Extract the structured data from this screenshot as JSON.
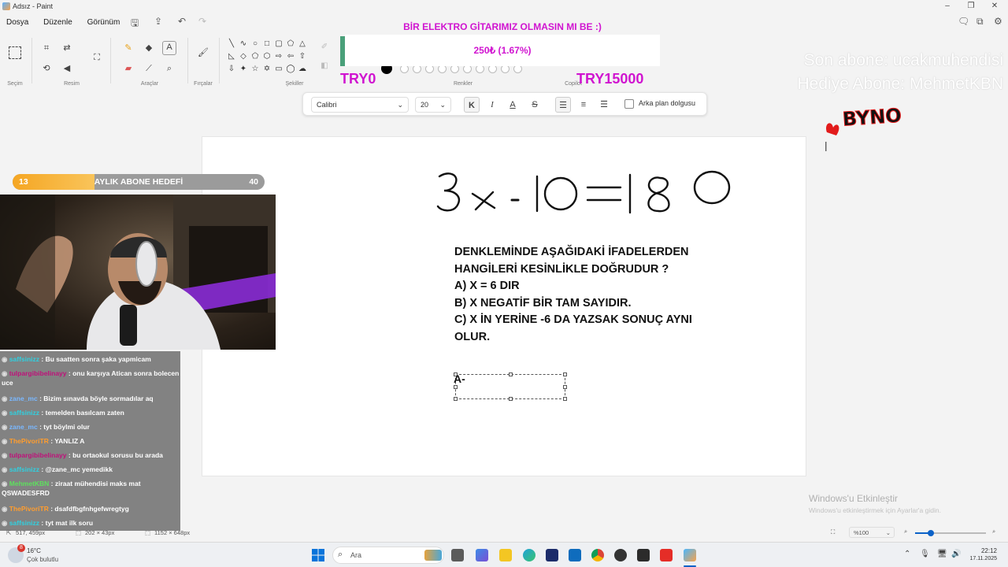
{
  "titlebar": {
    "title": "Adsız - Paint"
  },
  "menu": [
    "Dosya",
    "Düzenle",
    "Görünüm"
  ],
  "ribbon": {
    "groups": [
      "Seçim",
      "Resim",
      "Araçlar",
      "Fırçalar",
      "Şekiller",
      "Renkler",
      "Copilot"
    ]
  },
  "donation": {
    "title": "BİR ELEKTRO GİTARIMIZ OLMASIN MI BE :)",
    "amount": "250₺ (1.67%)",
    "from": "TRY0",
    "to": "TRY15000"
  },
  "last_sub": {
    "line1": "Son abone: ucakmuhendisi",
    "line2": "Hediye Abone: MehmetKBN"
  },
  "brand_logo": "BYNO",
  "text_toolbar": {
    "font": "Calibri",
    "size": "20",
    "bold": "K",
    "italic": "I",
    "underline": "A",
    "strike": "S",
    "background_fill": "Arka plan dolgusu"
  },
  "canvas": {
    "handwriting": "3x - 10 = 180",
    "question": [
      "DENKLEMİNDE AŞAĞIDAKİ İFADELERDEN",
      "HANGİLERİ KESİNLİKLE DOĞRUDUR ?",
      "A) X = 6 DIR",
      "B) X NEGATİF BİR TAM SAYIDIR.",
      "C) X İN YERİNE -6 DA YAZSAK SONUÇ AYNI",
      "OLUR."
    ],
    "answer": "A-"
  },
  "sub_goal": {
    "label": "AYLIK ABONE HEDEFİ",
    "current": "13",
    "target": "40",
    "progress": 0.325
  },
  "chat": [
    {
      "user": "saffsinizz",
      "text": "Bu saatten sonra şaka yapmicam",
      "color": "#30d0e0"
    },
    {
      "user": "tulpargibibelinayy",
      "text": "onu karşıya Atican sonra bolecen uce",
      "color": "#c0107a"
    },
    {
      "user": "zane_mc",
      "text": "Bizim sınavda böyle sormadılar aq",
      "color": "#7ab8ff"
    },
    {
      "user": "saffsinizz",
      "text": "temelden basılcam zaten",
      "color": "#30d0e0"
    },
    {
      "user": "zane_mc",
      "text": "tyt böylmi olur",
      "color": "#7ab8ff"
    },
    {
      "user": "ThePivoriTR",
      "text": "YANLIZ A",
      "color": "#ff9d2e"
    },
    {
      "user": "tulpargibibelinayy",
      "text": "bu ortaokul sorusu bu arada",
      "color": "#c0107a"
    },
    {
      "user": "saffsinizz",
      "text": "@zane_mc yemedikk",
      "color": "#30d0e0"
    },
    {
      "user": "MehmetKBN",
      "text": "ziraat mühendisi maks mat QSWADESFRD",
      "color": "#5ee05e"
    },
    {
      "user": "ThePivoriTR",
      "text": "dsafdfbgfnhgefwregtyg",
      "color": "#ff9d2e"
    },
    {
      "user": "saffsinizz",
      "text": "tyt mat ilk soru",
      "color": "#30d0e0"
    }
  ],
  "statusbar": {
    "cursor": "517, 459px",
    "selection": "202 × 43px",
    "canvas_size": "1152 × 648px",
    "zoom": "%100"
  },
  "watermark": {
    "line1": "Windows'u Etkinleştir",
    "line2": "Windows'u etkinleştirmek için Ayarlar'a gidin."
  },
  "taskbar": {
    "weather_temp": "16°C",
    "weather_desc": "Çok bulutlu",
    "search": "Ara",
    "time": "22:12",
    "date": "17.11.2025",
    "notif": "8"
  }
}
